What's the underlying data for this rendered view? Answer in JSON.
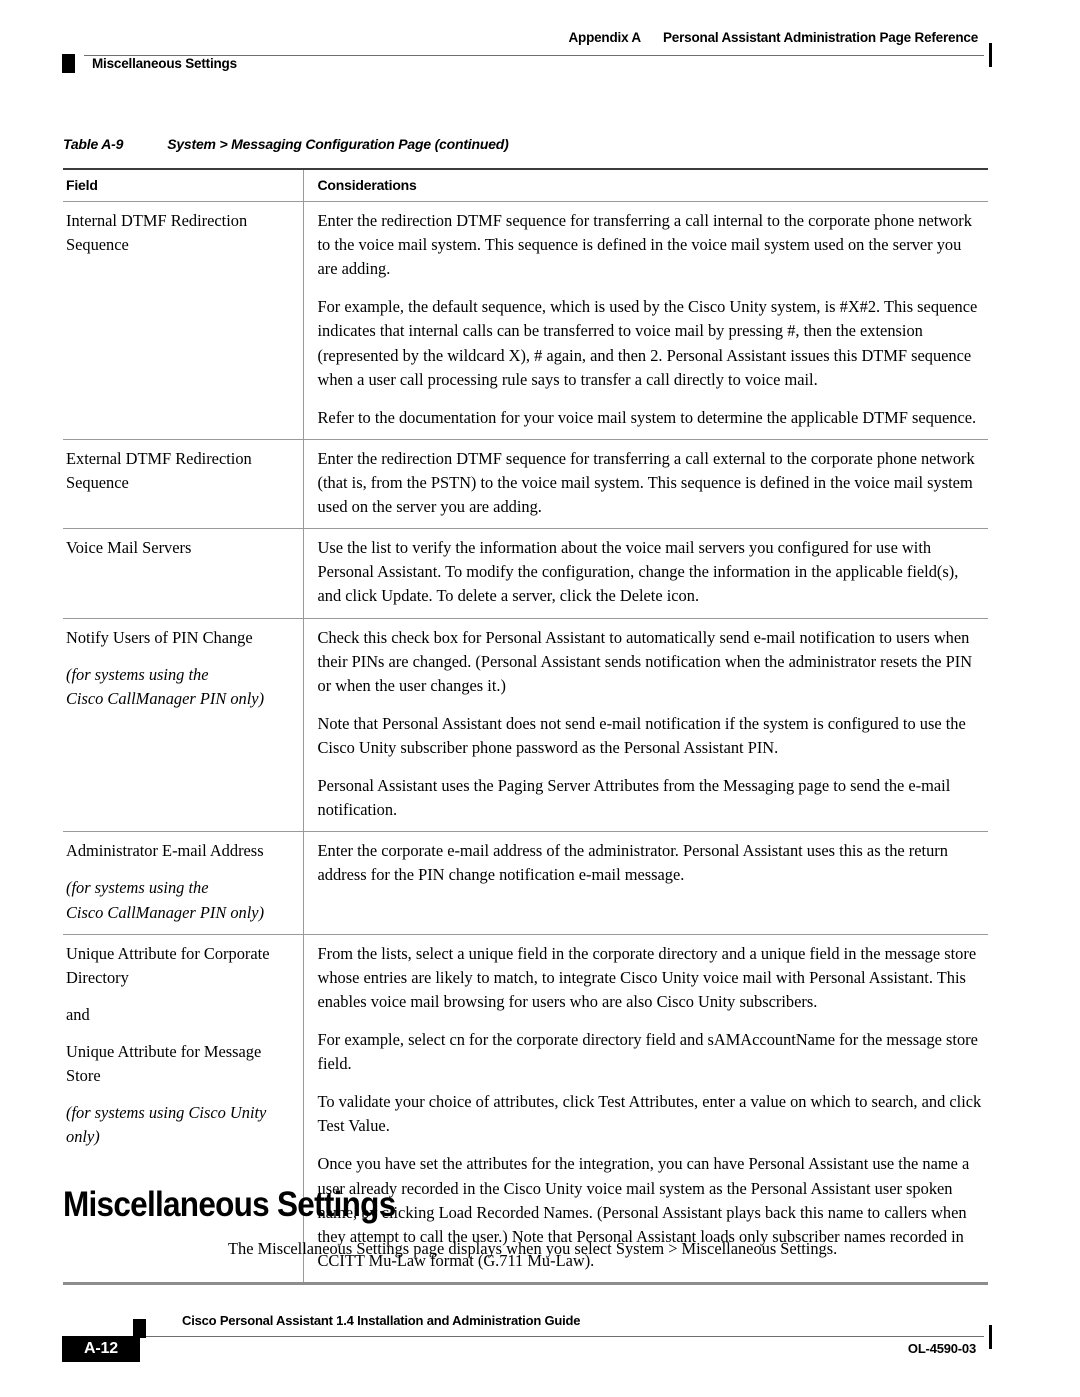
{
  "header": {
    "appendix_label": "Appendix A",
    "appendix_title": "Personal Assistant Administration Page Reference",
    "running_section": "Miscellaneous Settings"
  },
  "table": {
    "caption_number": "Table A-9",
    "caption_title": "System > Messaging Configuration Page (continued)",
    "columns": {
      "field": "Field",
      "considerations": "Considerations"
    },
    "rows": [
      {
        "field_main": "Internal DTMF Redirection Sequence",
        "field_note": null,
        "considerations": [
          "Enter the redirection DTMF sequence for transferring a call internal to the corporate phone network to the voice mail system. This sequence is defined in the voice mail system used on the server you are adding.",
          "For example, the default sequence, which is used by the Cisco Unity system, is #X#2. This sequence indicates that internal calls can be transferred to voice mail by pressing #, then the extension (represented by the wildcard X), # again, and then 2. Personal Assistant issues this DTMF sequence when a user call processing rule says to transfer a call directly to voice mail.",
          "Refer to the documentation for your voice mail system to determine the applicable DTMF sequence."
        ]
      },
      {
        "field_main": "External DTMF Redirection Sequence",
        "field_note": null,
        "considerations": [
          "Enter the redirection DTMF sequence for transferring a call external to the corporate phone network (that is, from the PSTN) to the voice mail system. This sequence is defined in the voice mail system used on the server you are adding."
        ]
      },
      {
        "field_main": "Voice Mail Servers",
        "field_note": null,
        "considerations": [
          "Use the list to verify the information about the voice mail servers you configured for use with Personal Assistant. To modify the configuration, change the information in the applicable field(s), and click Update. To delete a server, click the Delete icon."
        ]
      },
      {
        "field_main": "Notify Users of PIN Change",
        "field_note_line1": "(for systems using the",
        "field_note_line2": "Cisco CallManager PIN only)",
        "considerations": [
          "Check this check box for Personal Assistant to automatically send e-mail notification to users when their PINs are changed. (Personal Assistant sends notification when the administrator resets the PIN or when the user changes it.)",
          "Note that Personal Assistant does not send e-mail notification if the system is configured to use the Cisco Unity subscriber phone password as the Personal Assistant PIN.",
          "Personal Assistant uses the Paging Server Attributes from the Messaging page to send the e-mail notification."
        ]
      },
      {
        "field_main": "Administrator E-mail Address",
        "field_note_line1": "(for systems using the",
        "field_note_line2": "Cisco CallManager PIN only)",
        "considerations": [
          "Enter the corporate e-mail address of the administrator. Personal Assistant uses this as the return address for the PIN change notification e-mail message."
        ]
      },
      {
        "field_main": "Unique Attribute for Corporate Directory",
        "field_conjunction": "and",
        "field_second": "Unique Attribute for Message Store",
        "field_note_line1": "(for systems using Cisco Unity",
        "field_note_line2": "only)",
        "considerations": [
          "From the lists, select a unique field in the corporate directory and a unique field in the message store whose entries are likely to match, to integrate Cisco Unity voice mail with Personal Assistant. This enables voice mail browsing for users who are also Cisco Unity subscribers.",
          "For example, select cn for the corporate directory field and sAMAccountName for the message store field.",
          "To validate your choice of attributes, click Test Attributes, enter a value on which to search, and click Test Value.",
          "Once you have set the attributes for the integration, you can have Personal Assistant use the name a user already recorded in the Cisco Unity voice mail system as the Personal Assistant user spoken name, by clicking Load Recorded Names. (Personal Assistant plays back this name to callers when they attempt to call the user.) Note that Personal Assistant loads only subscriber names recorded in CCITT Mu-Law format (G.711 Mu-Law)."
        ]
      }
    ]
  },
  "section": {
    "heading": "Miscellaneous Settings",
    "body": "The Miscellaneous Settings page displays when you select System > Miscellaneous Settings."
  },
  "footer": {
    "guide_title": "Cisco Personal Assistant 1.4 Installation and Administration Guide",
    "page_number": "A-12",
    "doc_id": "OL-4590-03"
  }
}
